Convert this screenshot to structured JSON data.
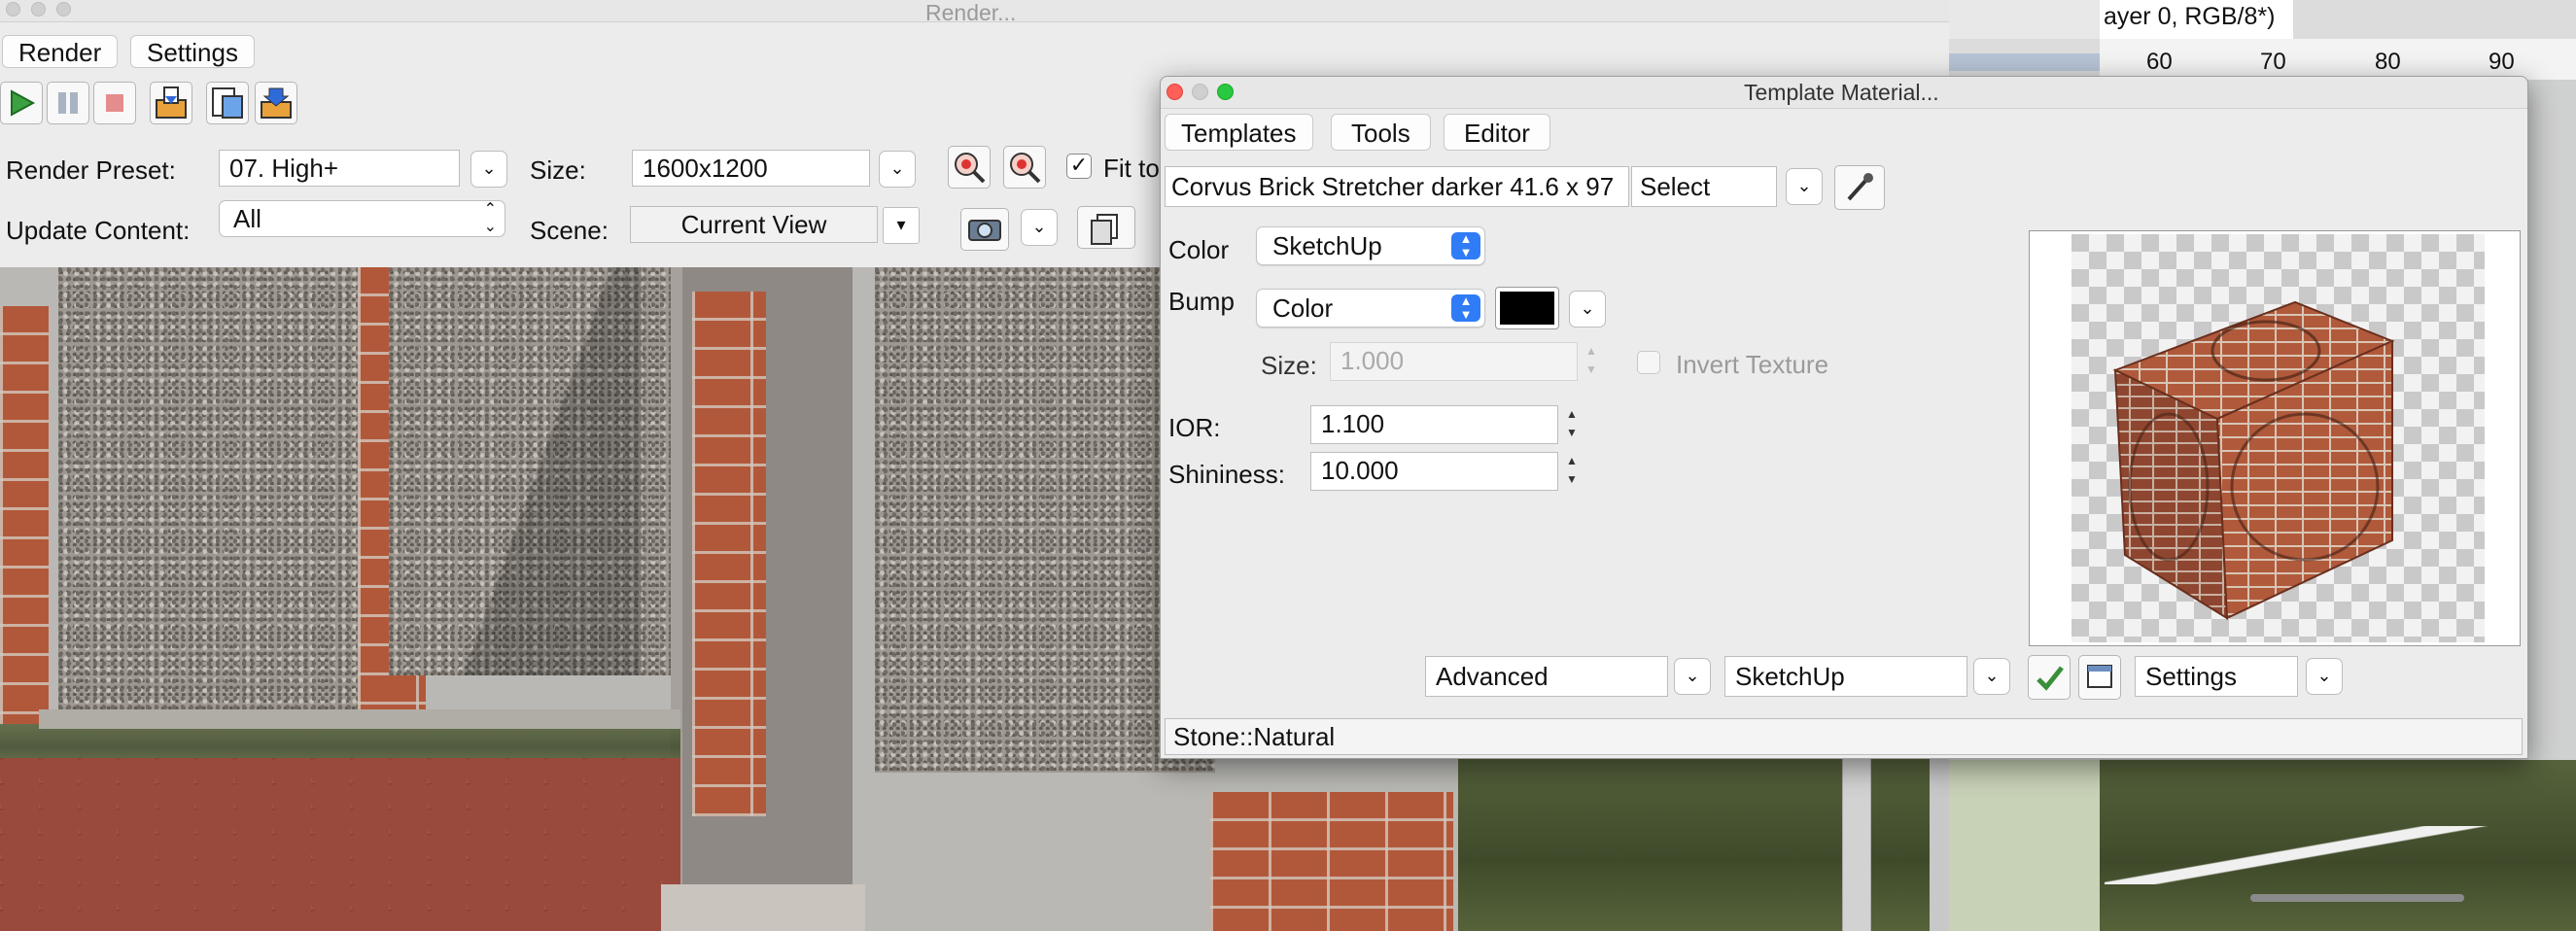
{
  "render_window": {
    "title": "Render...",
    "tabs": [
      "Render",
      "Settings"
    ],
    "toolbar_icons": [
      "play-icon",
      "pause-icon",
      "stop-icon",
      "import-icon",
      "export-icon",
      "save-icon"
    ],
    "render_preset_label": "Render Preset:",
    "render_preset_value": "07. High+",
    "size_label": "Size:",
    "size_value": "1600x1200",
    "fit_label": "Fit to",
    "update_content_label": "Update Content:",
    "update_content_value": "All",
    "scene_label": "Scene:",
    "scene_value": "Current View"
  },
  "background_app": {
    "title_fragment": "ayer 0, RGB/8*)",
    "ruler_ticks": [
      "60",
      "70",
      "80",
      "90"
    ]
  },
  "material_window": {
    "title": "Template Material...",
    "tabs": [
      "Templates",
      "Tools",
      "Editor"
    ],
    "material_name": "Corvus Brick Stretcher darker 41.6 x 97",
    "select_value": "Select",
    "color_label": "Color",
    "color_value": "SketchUp",
    "bump_label": "Bump",
    "bump_value": "Color",
    "bump_swatch_color": "#000000",
    "size_label": "Size:",
    "size_value": "1.000",
    "invert_texture_label": "Invert Texture",
    "ior_label": "IOR:",
    "ior_value": "1.100",
    "shininess_label": "Shininess:",
    "shininess_value": "10.000",
    "mode_value": "Advanced",
    "engine_value": "SketchUp",
    "settings_value": "Settings",
    "status_text": "Stone::Natural"
  },
  "colors": {
    "accent": "#2f7cf6",
    "window_bg": "#ececec",
    "close": "#fe5f57",
    "minimize": "#febc2e",
    "zoom": "#28c840"
  }
}
